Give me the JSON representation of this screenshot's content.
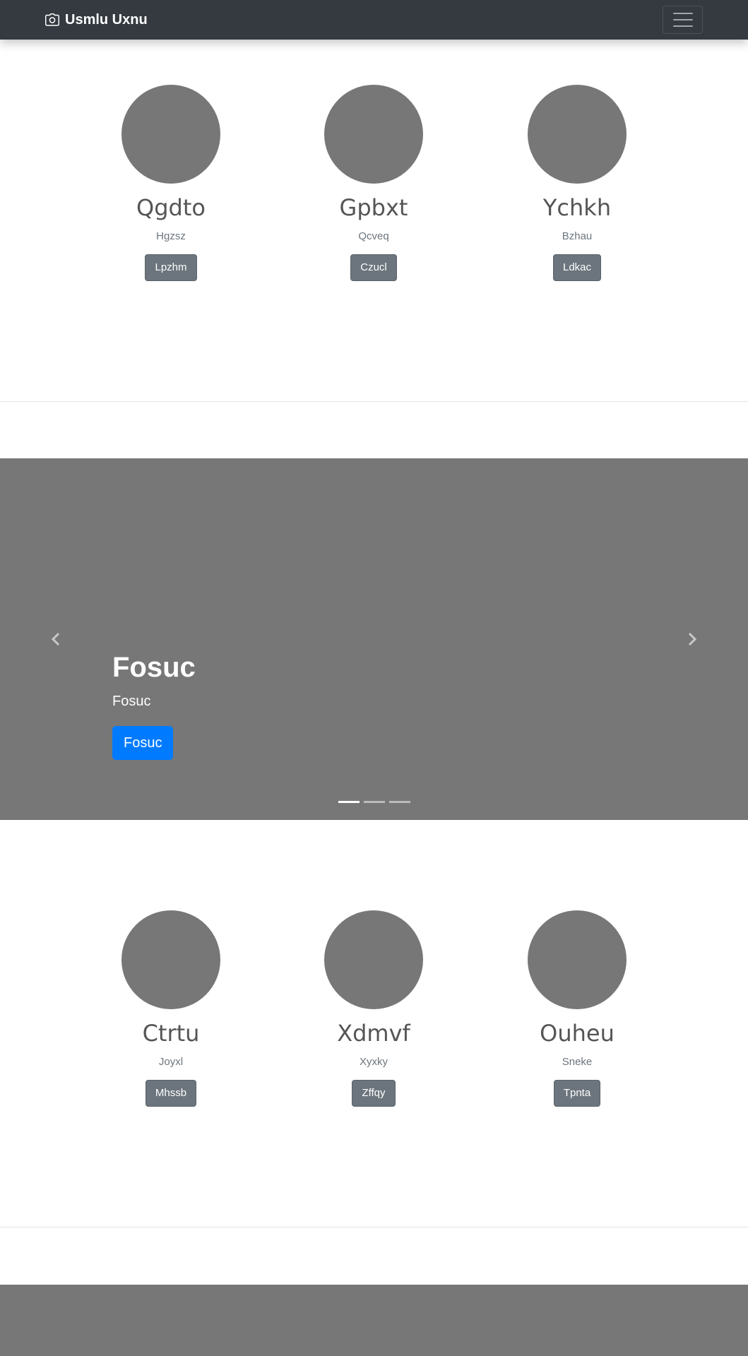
{
  "navbar": {
    "brand": "Usmlu Uxnu",
    "brand_icon": "camera-icon",
    "toggler_icon": "hamburger-menu-icon"
  },
  "cards_top": [
    {
      "title": "Qgdto",
      "subtitle": "Hgzsz",
      "button": "Lpzhm"
    },
    {
      "title": "Gpbxt",
      "subtitle": "Qcveq",
      "button": "Czucl"
    },
    {
      "title": "Ychkh",
      "subtitle": "Bzhau",
      "button": "Ldkac"
    }
  ],
  "carousel": {
    "heading": "Fosuc",
    "text": "Fosuc",
    "button": "Fosuc",
    "prev_icon": "chevron-left-icon",
    "next_icon": "chevron-right-icon",
    "slide_count": 3,
    "active_slide": 1
  },
  "cards_bottom": [
    {
      "title": "Ctrtu",
      "subtitle": "Joyxl",
      "button": "Mhssb"
    },
    {
      "title": "Xdmvf",
      "subtitle": "Xyxky",
      "button": "Zffqy"
    },
    {
      "title": "Ouheu",
      "subtitle": "Sneke",
      "button": "Tpnta"
    }
  ],
  "colors": {
    "navbar_bg": "#343a40",
    "placeholder_gray": "#777777",
    "secondary_button": "#6c757d",
    "primary_button": "#007bff"
  }
}
